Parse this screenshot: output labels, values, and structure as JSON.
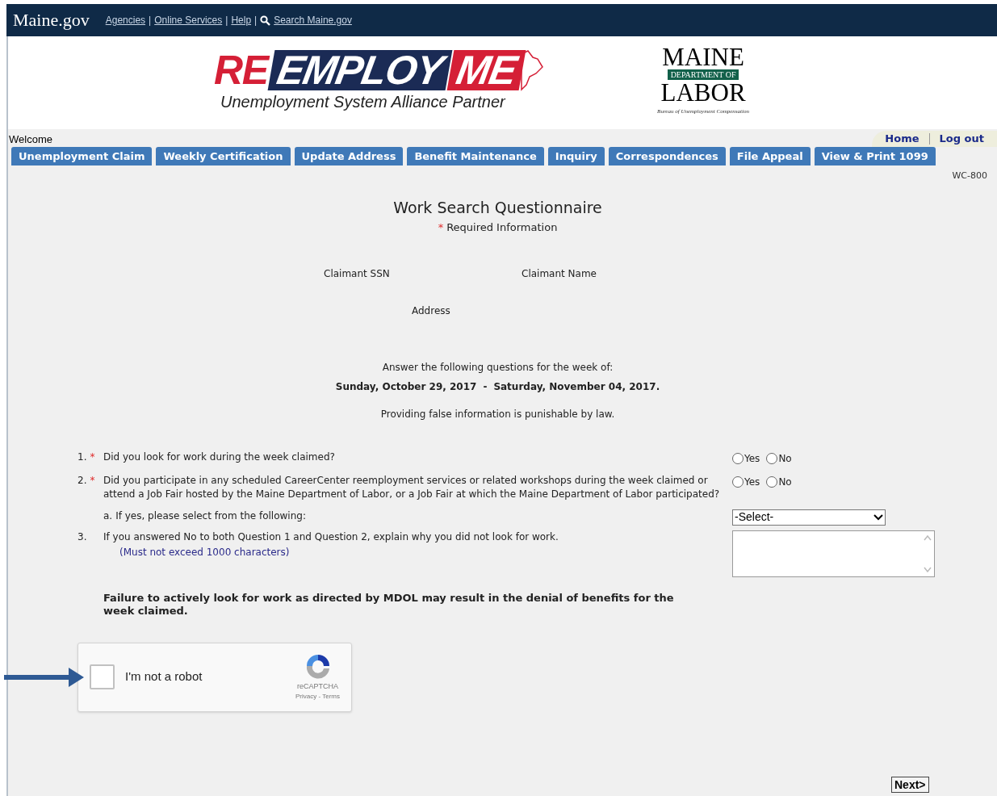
{
  "top_bar": {
    "site": "Maine.gov",
    "separator": "|",
    "links": [
      "Agencies",
      "Online Services",
      "Help",
      "Search Maine.gov"
    ]
  },
  "header": {
    "logo": {
      "parts": [
        "RE",
        "EMPLOY",
        "ME"
      ],
      "tagline": "Unemployment System Alliance Partner"
    },
    "dol_logo": {
      "top": "MAINE",
      "band": "DEPARTMENT OF",
      "bottom": "LABOR",
      "bureau": "Bureau of Unemployment Compensation"
    }
  },
  "welcome": "Welcome",
  "user_links": [
    "Home",
    "Log out"
  ],
  "tabs": [
    "Unemployment Claim",
    "Weekly Certification",
    "Update Address",
    "Benefit Maintenance",
    "Inquiry",
    "Correspondences",
    "File Appeal",
    "View & Print 1099"
  ],
  "form_id": "WC-800",
  "title": "Work Search Questionnaire",
  "required_mark": "*",
  "required_note": "Required Information",
  "claimant": {
    "ssn": "Claimant SSN",
    "name": "Claimant Name",
    "address": "Address"
  },
  "week": {
    "intro": "Answer the following questions for the week of:",
    "start": "Sunday, October 29, 2017",
    "separator": "-",
    "end": "Saturday, November 04, 2017."
  },
  "warning": "Providing false information is punishable by law.",
  "questions": [
    {
      "number": "1.",
      "required": true,
      "kind": "radio",
      "text": "Did you look for work during the week claimed?",
      "options": [
        {
          "label": "Yes",
          "selected": false
        },
        {
          "label": "No",
          "selected": false
        }
      ]
    },
    {
      "number": "2.",
      "required": true,
      "kind": "radio",
      "text": "Did you participate in any scheduled CareerCenter reemployment services or related workshops during the week claimed or attend a Job Fair hosted by the Maine Department of Labor, or a Job Fair at which the Maine Department of Labor participated?",
      "options": [
        {
          "label": "Yes",
          "selected": false
        },
        {
          "label": "No",
          "selected": false
        }
      ]
    },
    {
      "number": "a.",
      "required": false,
      "kind": "select",
      "text": "If yes, please select from the following:",
      "value": "-Select-"
    },
    {
      "number": "3.",
      "required": false,
      "kind": "textarea",
      "text": "If you answered No to both Question 1 and Question 2, explain why you did not look for work.",
      "note": "(Must not exceed 1000 characters)"
    }
  ],
  "notice": "Failure to actively look for work as directed by MDOL may result in the denial of benefits for the week claimed.",
  "captcha": {
    "label": "I'm not a robot",
    "checked": false,
    "brand": "reCAPTCHA",
    "links": "Privacy - Terms"
  },
  "next_button": "Next>"
}
